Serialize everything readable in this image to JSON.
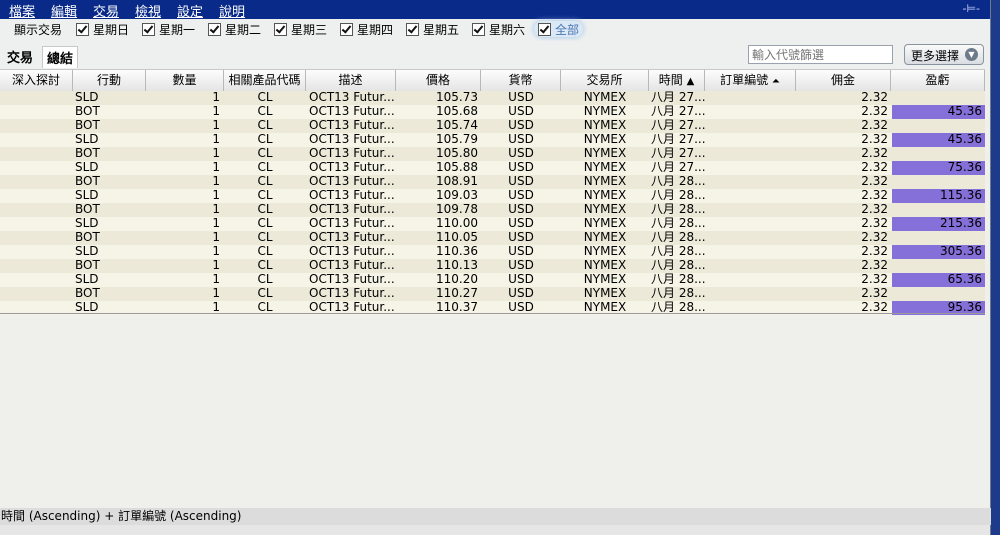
{
  "menu": [
    "檔案",
    "編輯",
    "交易",
    "檢視",
    "設定",
    "說明"
  ],
  "pin_glyph": "-⊨-",
  "filter_label": "顯示交易",
  "days": [
    "星期日",
    "星期一",
    "星期二",
    "星期三",
    "星期四",
    "星期五",
    "星期六",
    "全部"
  ],
  "tabs": [
    "交易",
    "總結"
  ],
  "search": {
    "placeholder": "輸入代號篩選"
  },
  "more_button": "更多選擇",
  "columns": [
    "深入探討",
    "行動",
    "數量",
    "相關產品代碼",
    "描述",
    "價格",
    "貨幣",
    "交易所",
    "時間",
    "訂單編號",
    "佣金",
    "盈虧"
  ],
  "rows": [
    {
      "action": "SLD",
      "qty": "1",
      "sym": "CL",
      "desc": "OCT13 Futur...",
      "price": "105.73",
      "cur": "USD",
      "exch": "NYMEX",
      "time": "八月 27...",
      "comm": "2.32",
      "pnl": ""
    },
    {
      "action": "BOT",
      "qty": "1",
      "sym": "CL",
      "desc": "OCT13 Futur...",
      "price": "105.68",
      "cur": "USD",
      "exch": "NYMEX",
      "time": "八月 27...",
      "comm": "2.32",
      "pnl": "45.36"
    },
    {
      "action": "BOT",
      "qty": "1",
      "sym": "CL",
      "desc": "OCT13 Futur...",
      "price": "105.74",
      "cur": "USD",
      "exch": "NYMEX",
      "time": "八月 27...",
      "comm": "2.32",
      "pnl": ""
    },
    {
      "action": "SLD",
      "qty": "1",
      "sym": "CL",
      "desc": "OCT13 Futur...",
      "price": "105.79",
      "cur": "USD",
      "exch": "NYMEX",
      "time": "八月 27...",
      "comm": "2.32",
      "pnl": "45.36"
    },
    {
      "action": "BOT",
      "qty": "1",
      "sym": "CL",
      "desc": "OCT13 Futur...",
      "price": "105.80",
      "cur": "USD",
      "exch": "NYMEX",
      "time": "八月 27...",
      "comm": "2.32",
      "pnl": ""
    },
    {
      "action": "SLD",
      "qty": "1",
      "sym": "CL",
      "desc": "OCT13 Futur...",
      "price": "105.88",
      "cur": "USD",
      "exch": "NYMEX",
      "time": "八月 27...",
      "comm": "2.32",
      "pnl": "75.36"
    },
    {
      "action": "BOT",
      "qty": "1",
      "sym": "CL",
      "desc": "OCT13 Futur...",
      "price": "108.91",
      "cur": "USD",
      "exch": "NYMEX",
      "time": "八月 28...",
      "comm": "2.32",
      "pnl": ""
    },
    {
      "action": "SLD",
      "qty": "1",
      "sym": "CL",
      "desc": "OCT13 Futur...",
      "price": "109.03",
      "cur": "USD",
      "exch": "NYMEX",
      "time": "八月 28...",
      "comm": "2.32",
      "pnl": "115.36"
    },
    {
      "action": "BOT",
      "qty": "1",
      "sym": "CL",
      "desc": "OCT13 Futur...",
      "price": "109.78",
      "cur": "USD",
      "exch": "NYMEX",
      "time": "八月 28...",
      "comm": "2.32",
      "pnl": ""
    },
    {
      "action": "SLD",
      "qty": "1",
      "sym": "CL",
      "desc": "OCT13 Futur...",
      "price": "110.00",
      "cur": "USD",
      "exch": "NYMEX",
      "time": "八月 28...",
      "comm": "2.32",
      "pnl": "215.36"
    },
    {
      "action": "BOT",
      "qty": "1",
      "sym": "CL",
      "desc": "OCT13 Futur...",
      "price": "110.05",
      "cur": "USD",
      "exch": "NYMEX",
      "time": "八月 28...",
      "comm": "2.32",
      "pnl": ""
    },
    {
      "action": "SLD",
      "qty": "1",
      "sym": "CL",
      "desc": "OCT13 Futur...",
      "price": "110.36",
      "cur": "USD",
      "exch": "NYMEX",
      "time": "八月 28...",
      "comm": "2.32",
      "pnl": "305.36"
    },
    {
      "action": "BOT",
      "qty": "1",
      "sym": "CL",
      "desc": "OCT13 Futur...",
      "price": "110.13",
      "cur": "USD",
      "exch": "NYMEX",
      "time": "八月 28...",
      "comm": "2.32",
      "pnl": ""
    },
    {
      "action": "SLD",
      "qty": "1",
      "sym": "CL",
      "desc": "OCT13 Futur...",
      "price": "110.20",
      "cur": "USD",
      "exch": "NYMEX",
      "time": "八月 28...",
      "comm": "2.32",
      "pnl": "65.36"
    },
    {
      "action": "BOT",
      "qty": "1",
      "sym": "CL",
      "desc": "OCT13 Futur...",
      "price": "110.27",
      "cur": "USD",
      "exch": "NYMEX",
      "time": "八月 28...",
      "comm": "2.32",
      "pnl": ""
    },
    {
      "action": "SLD",
      "qty": "1",
      "sym": "CL",
      "desc": "OCT13 Futur...",
      "price": "110.37",
      "cur": "USD",
      "exch": "NYMEX",
      "time": "八月 28...",
      "comm": "2.32",
      "pnl": "95.36"
    }
  ],
  "status": "時間 (Ascending)  +  訂單編號 (Ascending)",
  "colors": {
    "menubar": "#0a2a8a",
    "pnl_highlight": "#8470d8",
    "row": "#ece9d8"
  }
}
